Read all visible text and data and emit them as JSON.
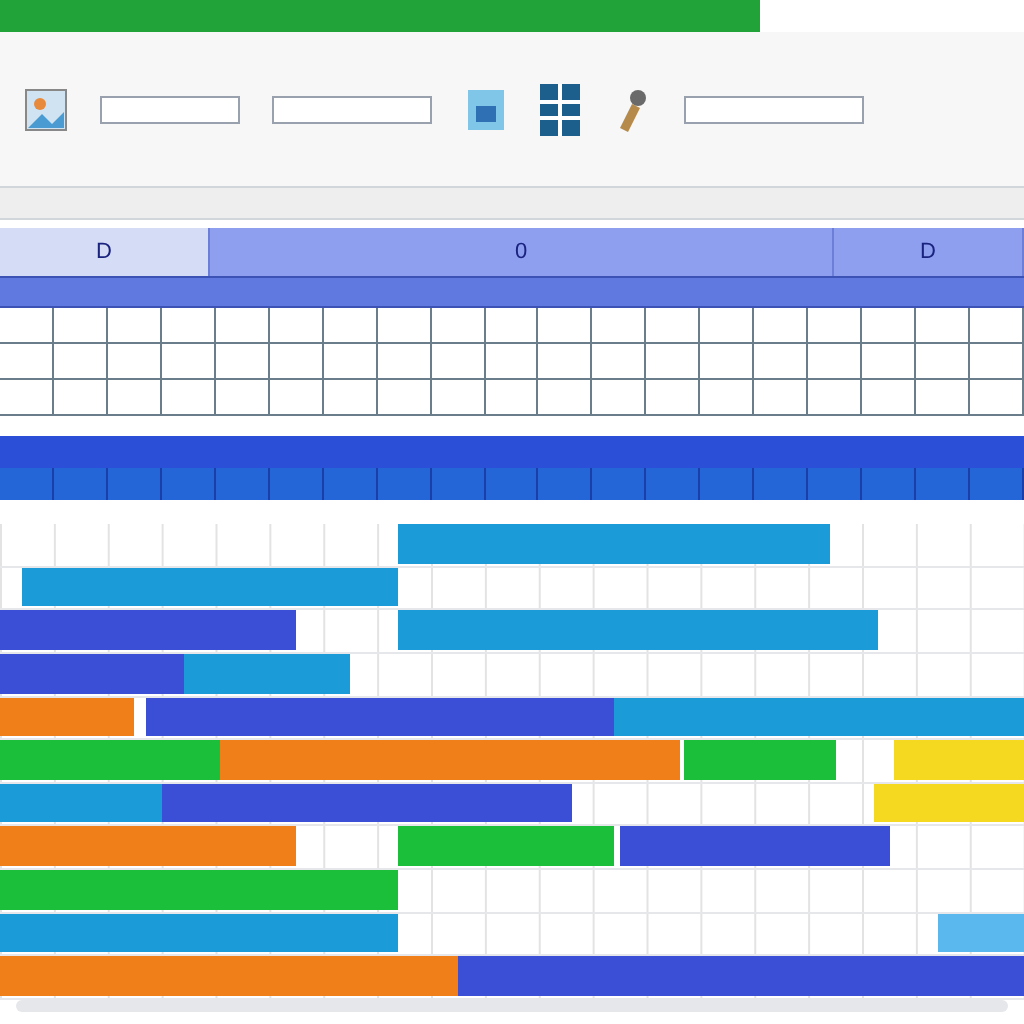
{
  "header": {
    "labels": [
      "D",
      "0",
      "D"
    ]
  },
  "gantt": {
    "rows": [
      {
        "bars": [
          {
            "color": "#1b9bd7"
          }
        ]
      },
      {
        "bars": [
          {
            "color": "#1b9bd7"
          }
        ]
      },
      {
        "bars": [
          {
            "color": "#3b4fd6"
          },
          {
            "color": "#1b9bd7"
          }
        ]
      },
      {
        "bars": [
          {
            "color": "#3b4fd6"
          },
          {
            "color": "#1b9bd7"
          }
        ]
      },
      {
        "bars": [
          {
            "color": "#f07f1a"
          },
          {
            "color": "#3b4fd6"
          },
          {
            "color": "#1b9bd7"
          }
        ]
      },
      {
        "bars": [
          {
            "color": "#1bbf3a"
          },
          {
            "color": "#f07f1a"
          },
          {
            "color": "#1bbf3a"
          },
          {
            "color": "#f5d820"
          }
        ]
      },
      {
        "bars": [
          {
            "color": "#1b9bd7"
          },
          {
            "color": "#3b4fd6"
          },
          {
            "color": "#f5d820"
          }
        ]
      },
      {
        "bars": [
          {
            "color": "#f07f1a"
          },
          {
            "color": "#1bbf3a"
          },
          {
            "color": "#3b4fd6"
          }
        ]
      },
      {
        "bars": [
          {
            "color": "#1bbf3a"
          }
        ]
      },
      {
        "bars": [
          {
            "color": "#1b9bd7"
          },
          {
            "color": "#5ab8ee"
          }
        ]
      },
      {
        "bars": [
          {
            "color": "#f07f1a"
          },
          {
            "color": "#3b4fd6"
          }
        ]
      }
    ]
  }
}
